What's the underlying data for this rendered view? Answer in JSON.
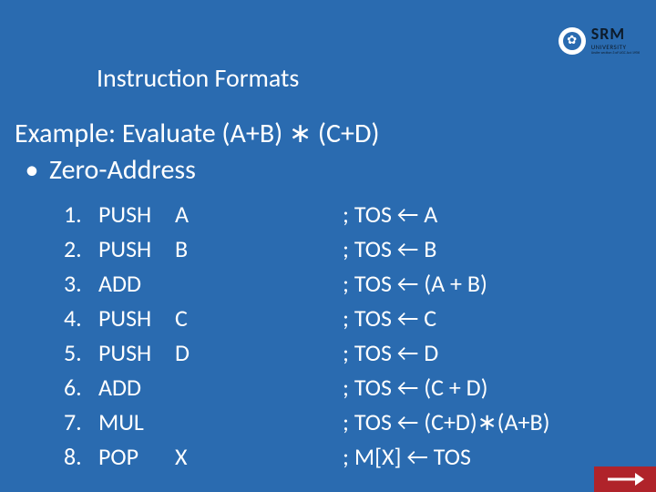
{
  "logo": {
    "name": "SRM",
    "subtitle": "UNIVERSITY",
    "tagline": "Under section 3 of UGC Act 1956"
  },
  "title": "Instruction Formats",
  "example_line": "Example:   Evaluate (A+B) ∗ (C+D)",
  "bullet": "•",
  "bullet_label": "Zero-Address",
  "instructions": [
    {
      "n": "1.",
      "op": "PUSH",
      "arg": "A",
      "comment": "; TOS ← A"
    },
    {
      "n": "2.",
      "op": "PUSH",
      "arg": "B",
      "comment": "; TOS ← B"
    },
    {
      "n": "3.",
      "op": "ADD",
      "arg": "",
      "comment": "; TOS ← (A + B)"
    },
    {
      "n": "4.",
      "op": "PUSH",
      "arg": "C",
      "comment": "; TOS ← C"
    },
    {
      "n": "5.",
      "op": "PUSH",
      "arg": "D",
      "comment": "; TOS ← D"
    },
    {
      "n": "6.",
      "op": "ADD",
      "arg": "",
      "comment": "; TOS ← (C + D)"
    },
    {
      "n": "7.",
      "op": "MUL",
      "arg": "",
      "comment": "; TOS ← (C+D)∗(A+B)"
    },
    {
      "n": "8.",
      "op": "POP",
      "arg": "X",
      "comment": "; M[X] ← TOS"
    }
  ]
}
